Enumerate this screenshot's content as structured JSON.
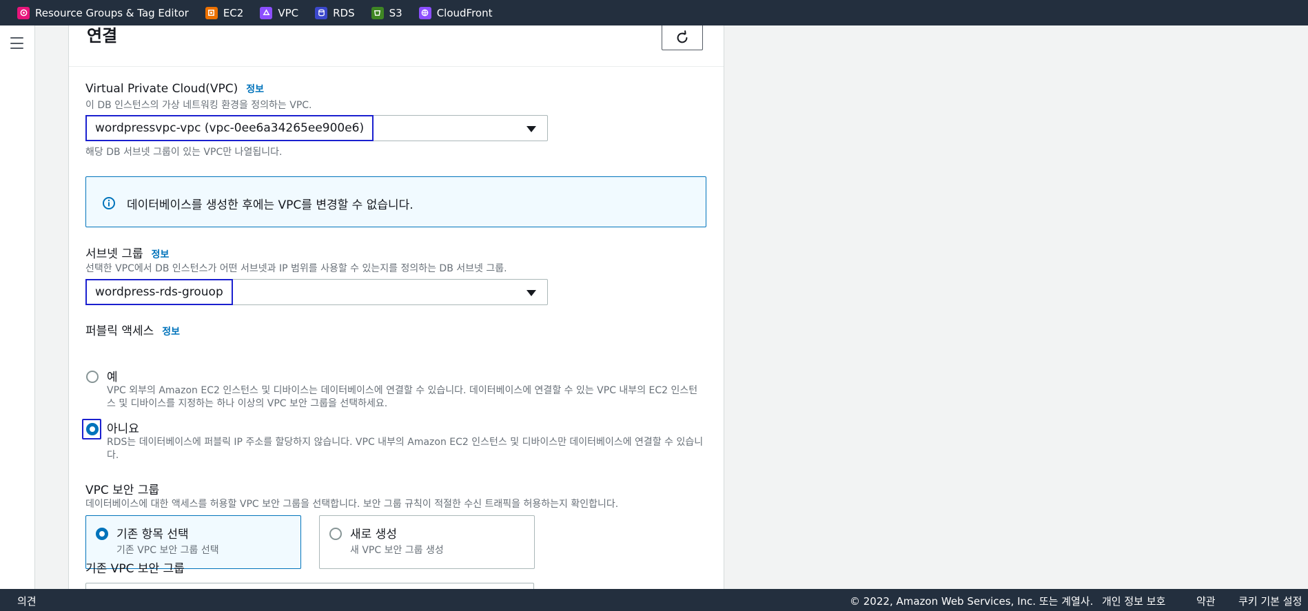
{
  "topbar": {
    "favorites": [
      {
        "label": "Resource Groups & Tag Editor",
        "icon": "resource-groups-icon",
        "color": "#e7157b"
      },
      {
        "label": "EC2",
        "icon": "ec2-icon",
        "color": "#ed7100"
      },
      {
        "label": "VPC",
        "icon": "vpc-icon",
        "color": "#8c4fff"
      },
      {
        "label": "RDS",
        "icon": "rds-icon",
        "color": "#3b48cc"
      },
      {
        "label": "S3",
        "icon": "s3-icon",
        "color": "#3f8624"
      },
      {
        "label": "CloudFront",
        "icon": "cloudfront-icon",
        "color": "#8c4fff"
      }
    ]
  },
  "leftnav": {
    "menu_icon": "hamburger-menu-icon"
  },
  "section": {
    "title": "연결",
    "refresh_icon": "refresh-icon"
  },
  "vpc": {
    "label": "Virtual Private Cloud(VPC)",
    "info": "정보",
    "description": "이 DB 인스턴스의 가상 네트워킹 환경을 정의하는 VPC.",
    "selected": "wordpressvpc-vpc (vpc-0ee6a34265ee900e6)",
    "hint": "해당 DB 서브넷 그룹이 있는 VPC만 나열됩니다."
  },
  "alert": {
    "icon": "info-circle-icon",
    "text": "데이터베이스를 생성한 후에는 VPC를 변경할 수 없습니다."
  },
  "subnet": {
    "label": "서브넷 그룹",
    "info": "정보",
    "description": "선택한 VPC에서 DB 인스턴스가 어떤 서브넷과 IP 범위를 사용할 수 있는지를 정의하는 DB 서브넷 그룹.",
    "selected": "wordpress-rds-grouop"
  },
  "public_access": {
    "label": "퍼블릭 액세스",
    "info": "정보",
    "options": [
      {
        "label": "예",
        "description": "VPC 외부의 Amazon EC2 인스턴스 및 디바이스는 데이터베이스에 연결할 수 있습니다. 데이터베이스에 연결할 수 있는 VPC 내부의 EC2 인스턴스 및 디바이스를 지정하는 하나 이상의 VPC 보안 그룹을 선택하세요.",
        "checked": false
      },
      {
        "label": "아니요",
        "description": "RDS는 데이터베이스에 퍼블릭 IP 주소를 할당하지 않습니다. VPC 내부의 Amazon EC2 인스턴스 및 디바이스만 데이터베이스에 연결할 수 있습니다.",
        "checked": true
      }
    ]
  },
  "security_group": {
    "label": "VPC 보안 그룹",
    "description": "데이터베이스에 대한 액세스를 허용할 VPC 보안 그룹을 선택합니다. 보안 그룹 규칙이 적절한 수신 트래픽을 허용하는지 확인합니다.",
    "tiles": [
      {
        "title": "기존 항목 선택",
        "subtitle": "기존 VPC 보안 그룹 선택",
        "selected": true
      },
      {
        "title": "새로 생성",
        "subtitle": "새 VPC 보안 그룹 생성",
        "selected": false
      }
    ]
  },
  "existing_group": {
    "label": "기존 VPC 보안 그룹"
  },
  "footer": {
    "feedback": "의견",
    "copyright": "© 2022, Amazon Web Services, Inc. 또는 계열사.",
    "privacy": "개인 정보 보호",
    "terms": "약관",
    "cookies": "쿠키 기본 설정"
  }
}
